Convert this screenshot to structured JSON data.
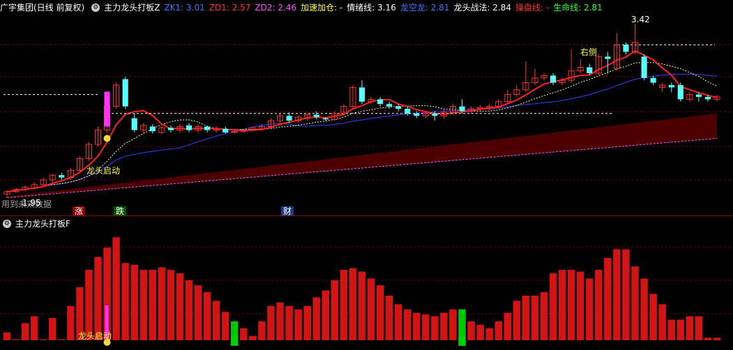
{
  "header": {
    "stock_name": "广宇集团(日线 前复权)",
    "indicator_name": "主力龙头打板Z",
    "zk1": "ZK1: 3.01",
    "zd1": "ZD1: 2.57",
    "zd2": "ZD2: 2.46",
    "jiasu": "加速加仓: -",
    "qingxu": "情绪线: 3.16",
    "longkong": "龙空龙: 2.81",
    "longtou_zhanfa": "龙头战法: 2.84",
    "caopan": "操盘线: -",
    "shengming": "生命线: 2.81"
  },
  "main_chart": {
    "high_label": "3.42",
    "low_label": "1.95",
    "launch_label": "龙头启动",
    "right_side_label": "右侧",
    "overlay_text": "用到未来数据",
    "tag_up": "涨",
    "tag_down": "跌",
    "tag_fin": "财"
  },
  "sub_panel": {
    "title": "主力龙头打板F",
    "launch_label": "龙头启动"
  },
  "colors": {
    "up": "#ff3232",
    "down": "#54ffff",
    "bg": "#000000",
    "grid": "#8b0000"
  },
  "chart_data": {
    "type": "candlestick",
    "candles": [
      [
        1.98,
        2.0,
        1.95,
        2.01
      ],
      [
        2.0,
        2.02,
        1.99,
        2.03
      ],
      [
        2.02,
        2.04,
        2.0,
        2.05
      ],
      [
        2.03,
        2.06,
        2.02,
        2.08
      ],
      [
        2.06,
        2.1,
        2.05,
        2.12
      ],
      [
        2.1,
        2.14,
        2.08,
        2.15
      ],
      [
        2.14,
        2.12,
        2.1,
        2.16
      ],
      [
        2.12,
        2.18,
        2.1,
        2.2
      ],
      [
        2.18,
        2.28,
        2.16,
        2.3
      ],
      [
        2.28,
        2.4,
        2.26,
        2.42
      ],
      [
        2.4,
        2.52,
        2.38,
        2.55
      ],
      [
        2.52,
        2.72,
        2.5,
        2.75
      ],
      [
        2.72,
        2.9,
        2.7,
        2.92
      ],
      [
        2.95,
        2.72,
        2.7,
        2.97
      ],
      [
        2.62,
        2.52,
        2.5,
        2.66
      ],
      [
        2.52,
        2.56,
        2.49,
        2.58
      ],
      [
        2.55,
        2.51,
        2.49,
        2.57
      ],
      [
        2.5,
        2.54,
        2.49,
        2.55
      ],
      [
        2.54,
        2.52,
        2.5,
        2.56
      ],
      [
        2.52,
        2.55,
        2.5,
        2.57
      ],
      [
        2.56,
        2.52,
        2.5,
        2.58
      ],
      [
        2.52,
        2.55,
        2.5,
        2.57
      ],
      [
        2.55,
        2.52,
        2.5,
        2.56
      ],
      [
        2.52,
        2.53,
        2.5,
        2.55
      ],
      [
        2.53,
        2.5,
        2.49,
        2.55
      ],
      [
        2.5,
        2.51,
        2.49,
        2.52
      ],
      [
        2.51,
        2.52,
        2.5,
        2.53
      ],
      [
        2.52,
        2.54,
        2.51,
        2.55
      ],
      [
        2.53,
        2.55,
        2.52,
        2.57
      ],
      [
        2.55,
        2.6,
        2.54,
        2.62
      ],
      [
        2.6,
        2.64,
        2.58,
        2.66
      ],
      [
        2.64,
        2.6,
        2.58,
        2.67
      ],
      [
        2.6,
        2.63,
        2.58,
        2.64
      ],
      [
        2.62,
        2.65,
        2.6,
        2.66
      ],
      [
        2.65,
        2.63,
        2.61,
        2.68
      ],
      [
        2.62,
        2.61,
        2.6,
        2.63
      ],
      [
        2.61,
        2.66,
        2.6,
        2.68
      ],
      [
        2.66,
        2.72,
        2.64,
        2.74
      ],
      [
        2.72,
        2.88,
        2.7,
        2.9
      ],
      [
        2.88,
        2.76,
        2.74,
        2.94
      ],
      [
        2.76,
        2.78,
        2.74,
        2.8
      ],
      [
        2.78,
        2.74,
        2.72,
        2.8
      ],
      [
        2.74,
        2.72,
        2.7,
        2.76
      ],
      [
        2.72,
        2.7,
        2.68,
        2.74
      ],
      [
        2.7,
        2.66,
        2.64,
        2.72
      ],
      [
        2.66,
        2.64,
        2.62,
        2.68
      ],
      [
        2.64,
        2.66,
        2.62,
        2.67
      ],
      [
        2.66,
        2.64,
        2.6,
        2.68
      ],
      [
        2.64,
        2.67,
        2.62,
        2.69
      ],
      [
        2.67,
        2.72,
        2.65,
        2.74
      ],
      [
        2.72,
        2.68,
        2.66,
        2.78
      ],
      [
        2.68,
        2.7,
        2.66,
        2.72
      ],
      [
        2.7,
        2.71,
        2.68,
        2.73
      ],
      [
        2.71,
        2.72,
        2.69,
        2.74
      ],
      [
        2.72,
        2.76,
        2.7,
        2.78
      ],
      [
        2.76,
        2.82,
        2.74,
        2.86
      ],
      [
        2.82,
        2.86,
        2.8,
        2.9
      ],
      [
        2.86,
        2.92,
        2.84,
        3.1
      ],
      [
        2.92,
        2.96,
        2.9,
        3.04
      ],
      [
        2.96,
        2.98,
        2.94,
        3.0
      ],
      [
        2.98,
        2.92,
        2.9,
        3.0
      ],
      [
        2.92,
        2.94,
        2.9,
        2.96
      ],
      [
        2.94,
        3.02,
        2.92,
        3.2
      ],
      [
        3.02,
        3.05,
        3.0,
        3.12
      ],
      [
        3.05,
        3.0,
        2.98,
        3.08
      ],
      [
        3.0,
        3.14,
        2.98,
        3.16
      ],
      [
        3.14,
        3.12,
        3.0,
        3.18
      ],
      [
        3.04,
        3.24,
        3.02,
        3.34
      ],
      [
        3.24,
        3.18,
        3.16,
        3.26
      ],
      [
        3.18,
        3.26,
        3.16,
        3.42
      ],
      [
        3.14,
        2.96,
        2.94,
        3.16
      ],
      [
        2.96,
        2.92,
        2.9,
        2.98
      ],
      [
        2.88,
        2.9,
        2.84,
        2.92
      ],
      [
        2.9,
        2.88,
        2.84,
        2.92
      ],
      [
        2.9,
        2.78,
        2.76,
        2.92
      ],
      [
        2.78,
        2.82,
        2.76,
        2.84
      ],
      [
        2.82,
        2.8,
        2.76,
        2.84
      ],
      [
        2.8,
        2.78,
        2.76,
        2.82
      ],
      [
        2.78,
        2.8,
        2.76,
        2.82
      ]
    ],
    "volume": [
      9,
      1,
      20,
      28,
      1,
      26,
      1,
      40,
      62,
      82,
      97,
      108,
      120,
      90,
      88,
      82,
      82,
      85,
      82,
      78,
      70,
      64,
      56,
      46,
      33,
      22,
      14,
      5,
      22,
      40,
      44,
      40,
      36,
      40,
      50,
      58,
      70,
      82,
      84,
      80,
      72,
      64,
      52,
      42,
      36,
      32,
      30,
      28,
      32,
      36,
      36,
      22,
      18,
      14,
      22,
      32,
      46,
      52,
      52,
      56,
      78,
      82,
      82,
      80,
      72,
      82,
      96,
      106,
      106,
      86,
      72,
      54,
      42,
      24,
      24,
      28,
      28,
      3,
      3
    ],
    "volume_up_flags": [
      1,
      1,
      1,
      1,
      1,
      1,
      1,
      1,
      1,
      1,
      1,
      1,
      1,
      1,
      1,
      1,
      1,
      1,
      1,
      1,
      1,
      1,
      1,
      1,
      1,
      0,
      1,
      1,
      1,
      1,
      1,
      1,
      1,
      1,
      1,
      1,
      1,
      1,
      1,
      1,
      1,
      1,
      1,
      1,
      1,
      1,
      1,
      1,
      1,
      1,
      0,
      1,
      1,
      1,
      1,
      1,
      1,
      1,
      1,
      1,
      1,
      1,
      1,
      1,
      1,
      1,
      1,
      1,
      1,
      1,
      1,
      1,
      1,
      1,
      1,
      1,
      1,
      1,
      1
    ],
    "ylim": [
      1.9,
      3.5
    ]
  }
}
